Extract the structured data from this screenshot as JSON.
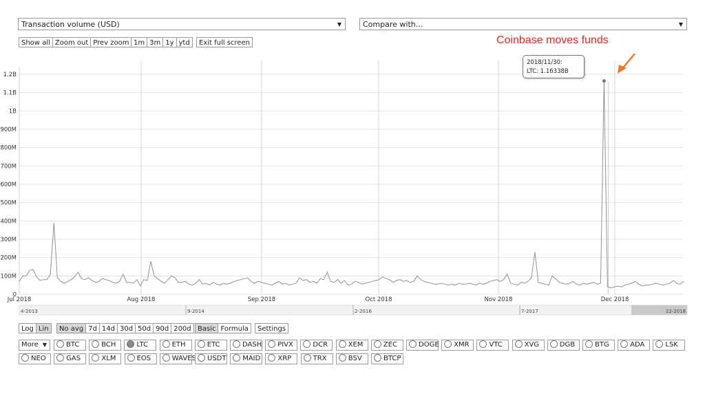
{
  "metric_select": {
    "value": "Transaction volume (USD)"
  },
  "compare_select": {
    "value": "Compare with..."
  },
  "zoom_buttons": [
    "Show all",
    "Zoom out",
    "Prev zoom"
  ],
  "range_buttons": [
    "1m",
    "3m",
    "1y",
    "ytd"
  ],
  "exit_button": "Exit full screen",
  "scale_buttons": [
    {
      "label": "Log",
      "active": false
    },
    {
      "label": "Lin",
      "active": true
    }
  ],
  "avg_buttons": [
    {
      "label": "No avg",
      "active": true
    },
    {
      "label": "7d"
    },
    {
      "label": "14d"
    },
    {
      "label": "30d"
    },
    {
      "label": "50d"
    },
    {
      "label": "90d"
    },
    {
      "label": "200d"
    }
  ],
  "mode_buttons": [
    {
      "label": "Basic",
      "active": true
    },
    {
      "label": "Formula"
    }
  ],
  "settings_button": "Settings",
  "annotation": "Coinbase moves funds",
  "tooltip": {
    "date": "2018/11/30:",
    "value": "LTC: 1.16338B"
  },
  "more_select": "More",
  "coins_row1": [
    "BTC",
    "BCH",
    "LTC",
    "ETH",
    "ETC",
    "DASH",
    "PIVX",
    "DCR",
    "XEM",
    "ZEC",
    "DOGE",
    "XMR",
    "VTC",
    "XVG",
    "DGB",
    "BTG",
    "ADA",
    "LSK"
  ],
  "coins_row2": [
    "NEO",
    "GAS",
    "XLM",
    "EOS",
    "WAVES",
    "USDT",
    "MAID",
    "XRP",
    "TRX",
    "BSV",
    "BTCP"
  ],
  "selected_coin": "LTC",
  "colors": {
    "line": "#909090",
    "annotation": "#e8291b",
    "arrow": "#f07a2a"
  },
  "chart_data": {
    "type": "line",
    "series": [
      {
        "name": "LTC",
        "x_start": "2018-07-01",
        "x_end": "2018-12-24",
        "values": [
          70,
          100,
          100,
          130,
          135,
          95,
          75,
          80,
          80,
          110,
          390,
          90,
          70,
          60,
          70,
          80,
          95,
          120,
          85,
          80,
          90,
          75,
          65,
          70,
          85,
          80,
          75,
          65,
          60,
          70,
          110,
          65,
          65,
          60,
          80,
          45,
          80,
          75,
          180,
          100,
          85,
          70,
          60,
          80,
          100,
          90,
          65,
          65,
          70,
          55,
          50,
          60,
          80,
          55,
          60,
          50,
          65,
          55,
          50,
          60,
          55,
          60,
          70,
          75,
          80,
          85,
          90,
          70,
          60,
          70,
          65,
          60,
          55,
          50,
          60,
          70,
          55,
          60,
          50,
          55,
          60,
          90,
          75,
          80,
          65,
          70,
          60,
          85,
          80,
          120,
          70,
          65,
          80,
          60,
          75,
          50,
          55,
          70,
          65,
          55,
          60,
          65,
          70,
          75,
          80,
          95,
          85,
          80,
          65,
          75,
          80,
          70,
          75,
          65,
          70,
          100,
          80,
          70,
          65,
          60,
          55,
          55,
          60,
          55,
          50,
          55,
          50,
          60,
          55,
          55,
          60,
          55,
          50,
          60,
          55,
          60,
          70,
          75,
          80,
          70,
          80,
          110,
          60,
          55,
          50,
          65,
          60,
          70,
          90,
          230,
          65,
          60,
          55,
          50,
          100,
          85,
          65,
          60,
          55,
          60,
          70,
          55,
          50,
          60,
          55,
          60,
          65,
          55,
          60,
          1163.38,
          40,
          35,
          40,
          45,
          40,
          50,
          55,
          60,
          70,
          55,
          45,
          50,
          50,
          55,
          60,
          55,
          50,
          55,
          60,
          75,
          60,
          55,
          70
        ]
      }
    ],
    "x_ticks": [
      "Jul 2018",
      "Aug 2018",
      "Sep 2018",
      "Oct 2018",
      "Nov 2018",
      "Dec 2018"
    ],
    "y_ticks": [
      "0",
      "100M",
      "200M",
      "300M",
      "400M",
      "500M",
      "600M",
      "700M",
      "800M",
      "900M",
      "1B",
      "1.1B",
      "1.2B"
    ],
    "y_unit": "millions USD",
    "ylim": [
      0,
      1200
    ],
    "grid": true,
    "peak": {
      "date": "2018/11/30",
      "value": "1.16338B"
    },
    "navigator_ticks": [
      "4-2013",
      "9-2014",
      "2-2016",
      "7-2017",
      "12-2018"
    ]
  }
}
